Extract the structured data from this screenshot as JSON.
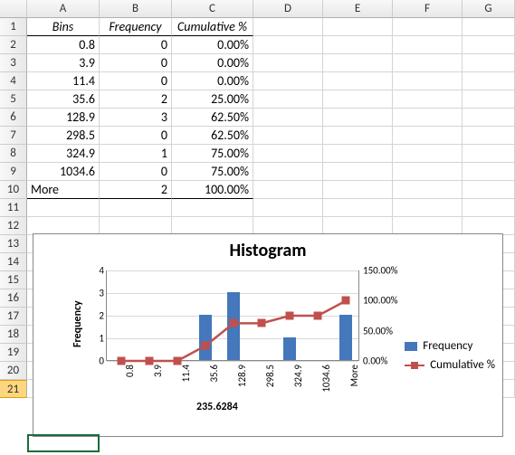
{
  "columns": [
    "",
    "A",
    "B",
    "C",
    "D",
    "E",
    "F",
    "G"
  ],
  "headers": {
    "bins": "Bins",
    "freq": "Frequency",
    "cum": "Cumulative %"
  },
  "rows": [
    {
      "bin": "0.8",
      "freq": "0",
      "cum": "0.00%"
    },
    {
      "bin": "3.9",
      "freq": "0",
      "cum": "0.00%"
    },
    {
      "bin": "11.4",
      "freq": "0",
      "cum": "0.00%"
    },
    {
      "bin": "35.6",
      "freq": "2",
      "cum": "25.00%"
    },
    {
      "bin": "128.9",
      "freq": "3",
      "cum": "62.50%"
    },
    {
      "bin": "298.5",
      "freq": "0",
      "cum": "62.50%"
    },
    {
      "bin": "324.9",
      "freq": "1",
      "cum": "75.00%"
    },
    {
      "bin": "1034.6",
      "freq": "0",
      "cum": "75.00%"
    },
    {
      "bin": "More",
      "freq": "2",
      "cum": "100.00%"
    }
  ],
  "chart": {
    "title": "Histogram",
    "ylabel": "Frequency",
    "xnumber": "235.6284",
    "legend": {
      "freq": "Frequency",
      "cum": "Cumulative %"
    },
    "yticks_left": [
      "0",
      "1",
      "2",
      "3",
      "4"
    ],
    "yticks_right": [
      "0.00%",
      "50.00%",
      "100.00%",
      "150.00%"
    ]
  },
  "chart_data": {
    "type": "bar",
    "categories": [
      "0.8",
      "3.9",
      "11.4",
      "35.6",
      "128.9",
      "298.5",
      "324.9",
      "1034.6",
      "More"
    ],
    "series": [
      {
        "name": "Frequency",
        "values": [
          0,
          0,
          0,
          2,
          3,
          0,
          1,
          0,
          2
        ],
        "type": "bar",
        "axis": "left"
      },
      {
        "name": "Cumulative %",
        "values": [
          0,
          0,
          0,
          25,
          62.5,
          62.5,
          75,
          75,
          100
        ],
        "type": "line",
        "axis": "right"
      }
    ],
    "title": "Histogram",
    "ylabel": "Frequency",
    "ylim_left": [
      0,
      4
    ],
    "ylim_right": [
      0,
      150
    ]
  }
}
